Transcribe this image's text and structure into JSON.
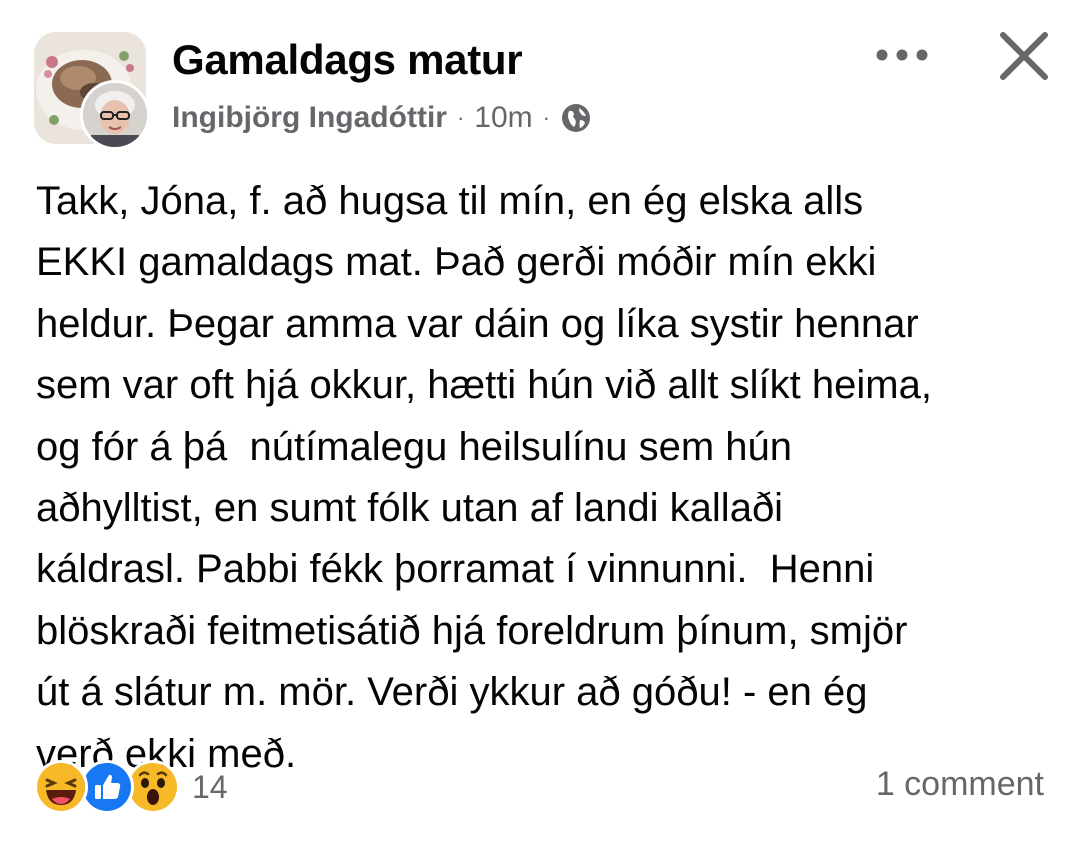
{
  "post": {
    "group_name": "Gamaldags matur",
    "author": "Ingibjörg Ingadóttir",
    "separator": "·",
    "time": "10m",
    "audience_icon": "globe-icon",
    "text_lines": [
      "Takk, Jóna, f. að hugsa til mín, en ég elska alls",
      "EKKI gamaldags mat. Það gerði móðir mín ekki",
      "heldur. Þegar amma var dáin og líka systir hennar",
      "sem var oft hjá okkur, hætti hún við allt slíkt heima,",
      "og fór á þá  nútímalegu heilsulínu sem hún",
      "aðhylltist, en sumt fólk utan af landi kallaði",
      "káldrasl. Pabbi fékk þorramat í vinnunni.  Henni",
      "blöskraði feitmetisátið hjá foreldrum þínum, smjör",
      "út á slátur m. mör. Verði ykkur að góðu! - en ég",
      "verð ekki með."
    ]
  },
  "header_actions": {
    "more_icon": "more-horizontal-icon",
    "close_icon": "close-icon"
  },
  "footer": {
    "reactions": [
      "haha-reaction-icon",
      "like-reaction-icon",
      "wow-reaction-icon"
    ],
    "reaction_count": "14",
    "comments_label": "1 comment"
  },
  "colors": {
    "text_primary": "#050505",
    "text_secondary": "#65676b",
    "like_blue": "#1877f2",
    "emoji_yellow": "#f7b928"
  }
}
